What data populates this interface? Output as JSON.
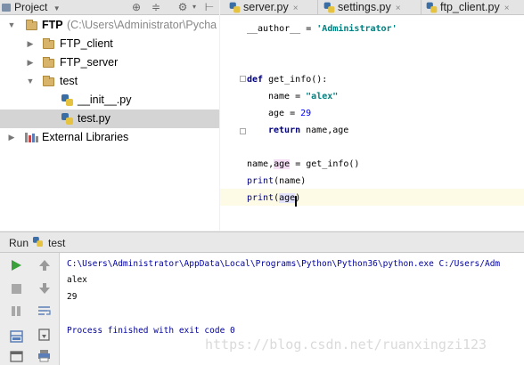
{
  "project_panel": {
    "title": "Project",
    "tree": [
      {
        "label": "FTP",
        "path": "(C:\\Users\\Administrator\\Pycha",
        "kind": "folder",
        "expanded": true
      },
      {
        "label": "FTP_client",
        "kind": "folder",
        "expanded": false
      },
      {
        "label": "FTP_server",
        "kind": "folder",
        "expanded": false
      },
      {
        "label": "test",
        "kind": "folder",
        "expanded": true
      },
      {
        "label": "__init__.py",
        "kind": "python-file"
      },
      {
        "label": "test.py",
        "kind": "python-file",
        "selected": true
      },
      {
        "label": "External Libraries",
        "kind": "library",
        "expanded": false
      }
    ]
  },
  "editor": {
    "tabs": [
      {
        "label": "server.py"
      },
      {
        "label": "settings.py"
      },
      {
        "label": "ftp_client.py"
      }
    ],
    "code": {
      "author_var": "__author__",
      "author_eq": " = ",
      "author_val": "'Administrator'",
      "def_kw": "def",
      "func_sig": " get_info():",
      "name_assign": "name = ",
      "name_val": "\"alex\"",
      "age_assign": "age = ",
      "age_val": "29",
      "return_kw": "return",
      "return_vals": " name,age",
      "unpack_pre": "name,",
      "unpack_age": "age",
      "unpack_post": " = get_info()",
      "print1_fn": "print",
      "print1_args": "(name)",
      "print2_fn": "print",
      "print2_open": "(",
      "print2_age": "age",
      "print2_close": ")"
    }
  },
  "run_panel": {
    "label": "Run",
    "config": "test",
    "output": [
      "C:\\Users\\Administrator\\AppData\\Local\\Programs\\Python\\Python36\\python.exe C:/Users/Adm",
      "alex",
      "29",
      "",
      "Process finished with exit code 0"
    ]
  },
  "watermark": "https://blog.csdn.net/ruanxingzi123",
  "colors": {
    "keyword": "#000080",
    "string": "#008080",
    "number": "#0000ff",
    "selection": "#d4d4d4",
    "current_line": "#fdfbe6",
    "run_green": "#3aa03a"
  }
}
